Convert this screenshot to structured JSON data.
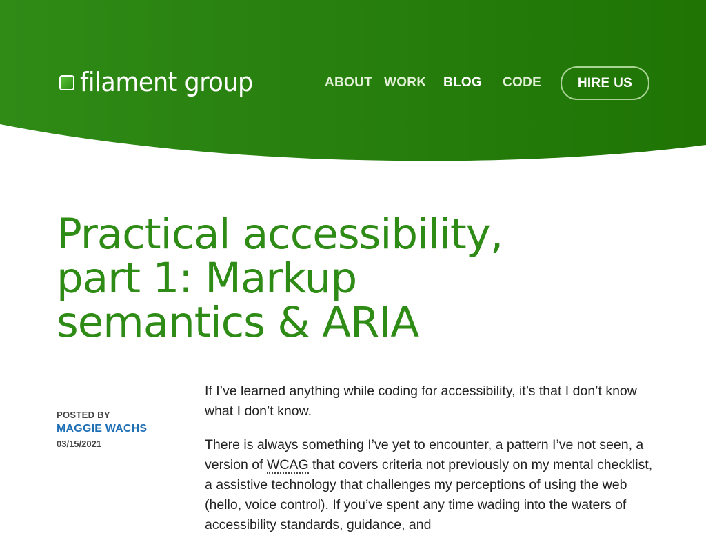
{
  "brand": {
    "name": "filament group"
  },
  "nav": {
    "items": [
      {
        "label": "ABOUT"
      },
      {
        "label": "WORK"
      },
      {
        "label": "BLOG"
      },
      {
        "label": "CODE"
      }
    ],
    "cta": "HIRE US"
  },
  "article": {
    "title": "Practical accessibility, part 1: Markup semantics & ARIA",
    "posted_by_label": "POSTED BY",
    "author": "MAGGIE WACHS",
    "date": "03/15/2021",
    "p1": "If I’ve learned anything while coding for accessibility, it’s that I don’t know what I don’t know.",
    "p2_before": "There is always something I’ve yet to encounter, a pattern I’ve not seen, a version of ",
    "p2_abbr": "WCAG",
    "p2_after": " that covers criteria not previously on my mental checklist, a assistive technology that challenges my perceptions of using the web (hello, voice control). If you’ve spent any time wading into the waters of accessibility standards, guidance, and"
  },
  "colors": {
    "header_green": "#247a10",
    "title_green": "#2e8b15",
    "author_blue": "#1f6fb5"
  },
  "icons": {
    "logo": "filament-square-icon"
  }
}
